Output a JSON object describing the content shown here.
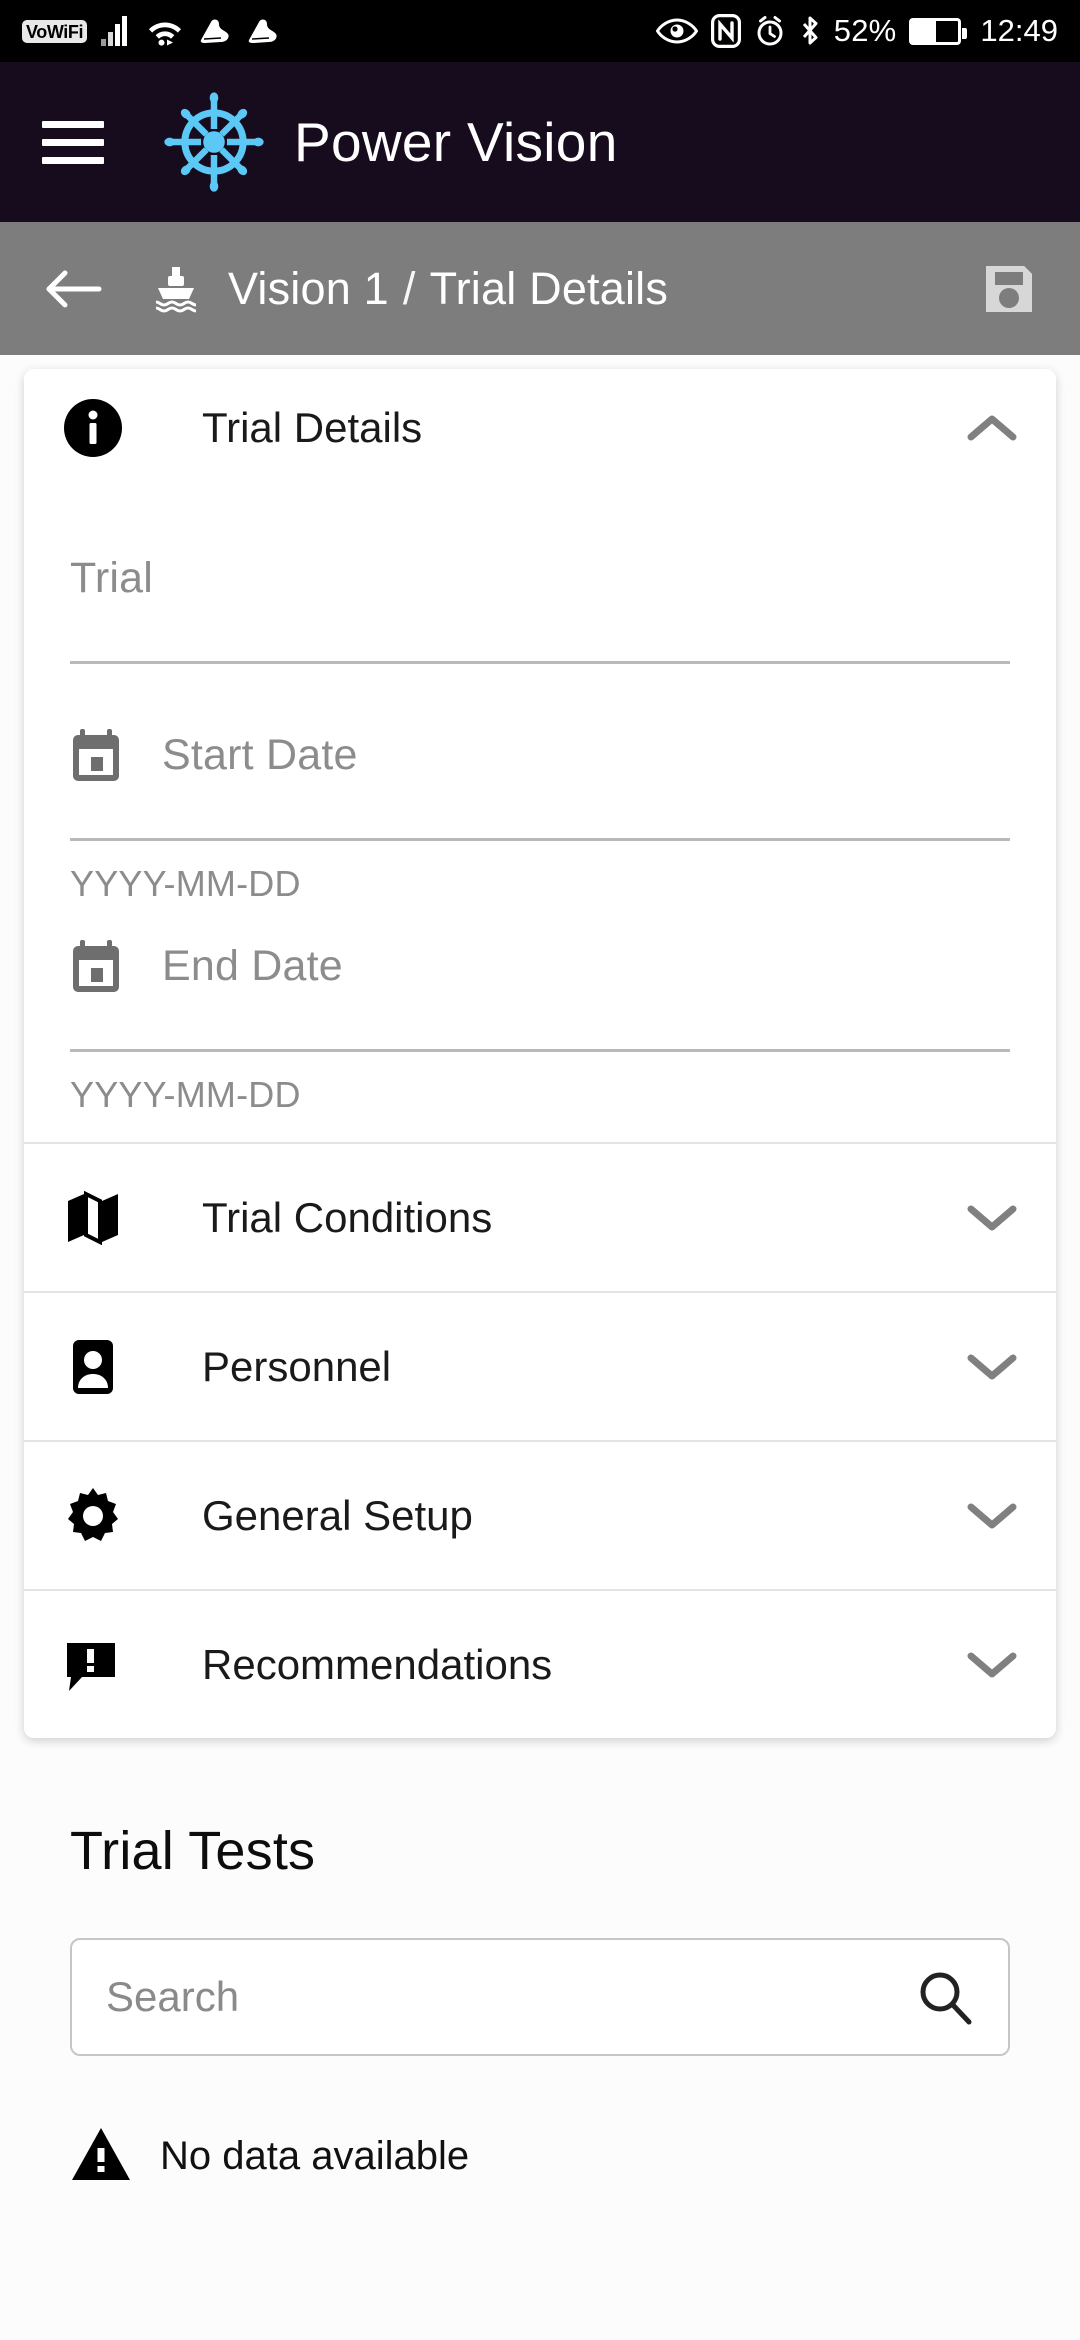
{
  "status_bar": {
    "vowifi_label": "VoWiFi",
    "icons_left": [
      "vowifi-badge",
      "cellular-signal-icon",
      "wifi-icon",
      "step-counter-icon",
      "step-counter-icon"
    ],
    "icons_right": [
      "eye-comfort-icon",
      "nfc-icon",
      "alarm-icon",
      "bluetooth-icon"
    ],
    "battery_percent": "52%",
    "battery_level": 52,
    "time": "12:49"
  },
  "app_bar": {
    "menu_icon": "hamburger-menu-icon",
    "logo_icon": "ship-wheel-logo",
    "logo_color": "#5bc8f5",
    "title": "Power Vision",
    "background_color": "#170b1e"
  },
  "breadcrumb_bar": {
    "back_icon": "back-arrow-icon",
    "vessel_icon": "ship-icon",
    "vessel": "Vision 1",
    "separator": "/",
    "page": "Trial Details",
    "save_icon": "save-floppy-icon",
    "background_color": "#7d7d7d"
  },
  "trial_details": {
    "icon": "info-icon",
    "title": "Trial Details",
    "chevron": "chevron-up-icon",
    "expanded": true,
    "fields": [
      {
        "name": "trial",
        "placeholder": "Trial",
        "value": "",
        "icon": null,
        "hint": ""
      },
      {
        "name": "start-date",
        "placeholder": "Start Date",
        "value": "",
        "icon": "calendar-icon",
        "hint": "YYYY-MM-DD"
      },
      {
        "name": "end-date",
        "placeholder": "End Date",
        "value": "",
        "icon": "calendar-icon",
        "hint": "YYYY-MM-DD"
      }
    ]
  },
  "sections": [
    {
      "name": "trial-conditions",
      "icon": "map-icon",
      "label": "Trial Conditions",
      "chevron": "chevron-down-icon"
    },
    {
      "name": "personnel",
      "icon": "contact-icon",
      "label": "Personnel",
      "chevron": "chevron-down-icon"
    },
    {
      "name": "general-setup",
      "icon": "gear-icon",
      "label": "General Setup",
      "chevron": "chevron-down-icon"
    },
    {
      "name": "recommendations",
      "icon": "comment-alert-icon",
      "label": "Recommendations",
      "chevron": "chevron-down-icon"
    }
  ],
  "trial_tests": {
    "title": "Trial Tests",
    "search": {
      "placeholder": "Search",
      "value": "",
      "icon": "search-icon"
    },
    "empty_state": {
      "icon": "warning-triangle-icon",
      "text": "No data available"
    }
  }
}
